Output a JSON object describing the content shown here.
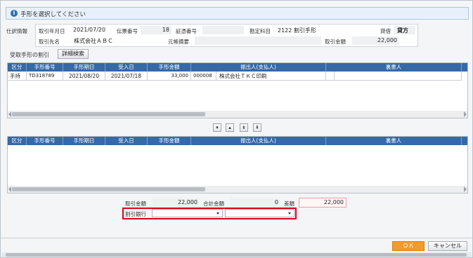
{
  "message": {
    "icon": "info-icon",
    "text": "手形を選択してください"
  },
  "journal": {
    "section_label": "仕訳情報",
    "date_label": "取引年月日",
    "date_value": "2021/07/20",
    "voucher_label": "伝票番号",
    "voucher_value": "18",
    "evidence_label": "証憑番号",
    "evidence_value": "",
    "account_label": "勘定科目",
    "account_value": "2122 割引手形",
    "debit_credit_label": "貸借",
    "debit_credit_value": "貸方",
    "partner_label": "取引先名",
    "partner_value": "株式会社ＡＢＣ",
    "ledger_label": "元帳摘要",
    "ledger_value": "",
    "amount_label": "取引金額",
    "amount_value": "22,000"
  },
  "subheader": {
    "label": "受取手形の割引",
    "detail_search_button": "詳細検索"
  },
  "columns": [
    "区分",
    "手形番号",
    "手形期日",
    "受入日",
    "手形金額",
    "振出人(支払人)",
    "裏書人"
  ],
  "upper_rows": [
    [
      "手持",
      "TD318789",
      "2021/08/20",
      "2021/07/18",
      "33,000",
      "000008",
      "株式会社ＴＫＣ印刷"
    ]
  ],
  "move_buttons": [
    "▾",
    "▴",
    "⇟",
    "⇞"
  ],
  "totals": {
    "amount_label": "取引金額",
    "amount_value": "22,000",
    "sum_label": "合計金額",
    "sum_value": "0",
    "diff_label": "差額",
    "diff_value": "22,000",
    "bank_label": "割引銀行",
    "bank_value_1": "",
    "bank_value_2": ""
  },
  "footer": {
    "ok_label": "ＯＫ",
    "cancel_label": "キャンセル"
  },
  "colors": {
    "accent": "#f39a2c",
    "header": "#3569a8",
    "highlight": "#e0001a"
  }
}
